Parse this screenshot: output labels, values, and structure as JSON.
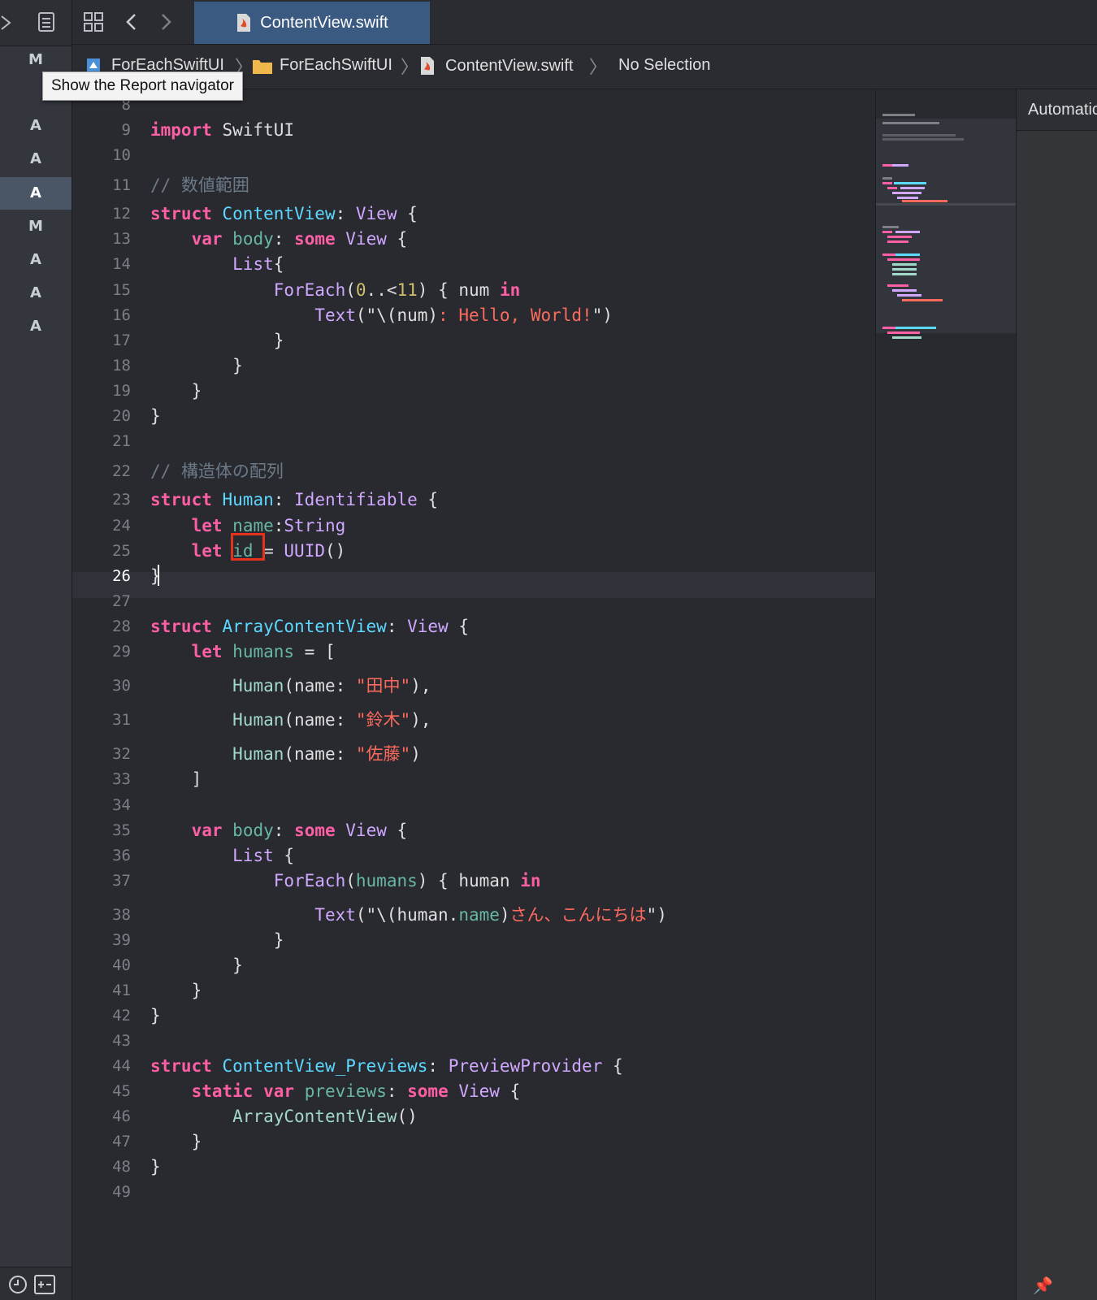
{
  "tab": {
    "active_label": "ContentView.swift"
  },
  "jumpbar": {
    "project": "ForEachSwiftUI",
    "group": "ForEachSwiftUI",
    "file": "ContentView.swift",
    "selection": "No Selection"
  },
  "tooltip": {
    "text": "Show the Report navigator"
  },
  "navigator": {
    "status_letters": [
      "M",
      "A",
      "A",
      "A",
      "M",
      "A",
      "A",
      "A"
    ],
    "selected_index": 3
  },
  "preview": {
    "header": "Automatic"
  },
  "editor": {
    "current_line": 26,
    "first_line_number": 8
  },
  "colors": {
    "keyword": "#fc5fa3",
    "type": "#d0a8ff",
    "user_type": "#5dd8ff",
    "string": "#fc6a5d",
    "number": "#d0bf69",
    "comment": "#6c7986",
    "tab_active": "#3b5a82",
    "highlight_box": "#e5321f"
  },
  "icons": [
    "navigator-toggle-icon",
    "document-list-icon",
    "grid-icon",
    "back-chevron-icon",
    "forward-chevron-icon",
    "swift-file-icon",
    "project-icon",
    "folder-icon",
    "clock-icon",
    "add-remove-icon",
    "pin-icon"
  ]
}
